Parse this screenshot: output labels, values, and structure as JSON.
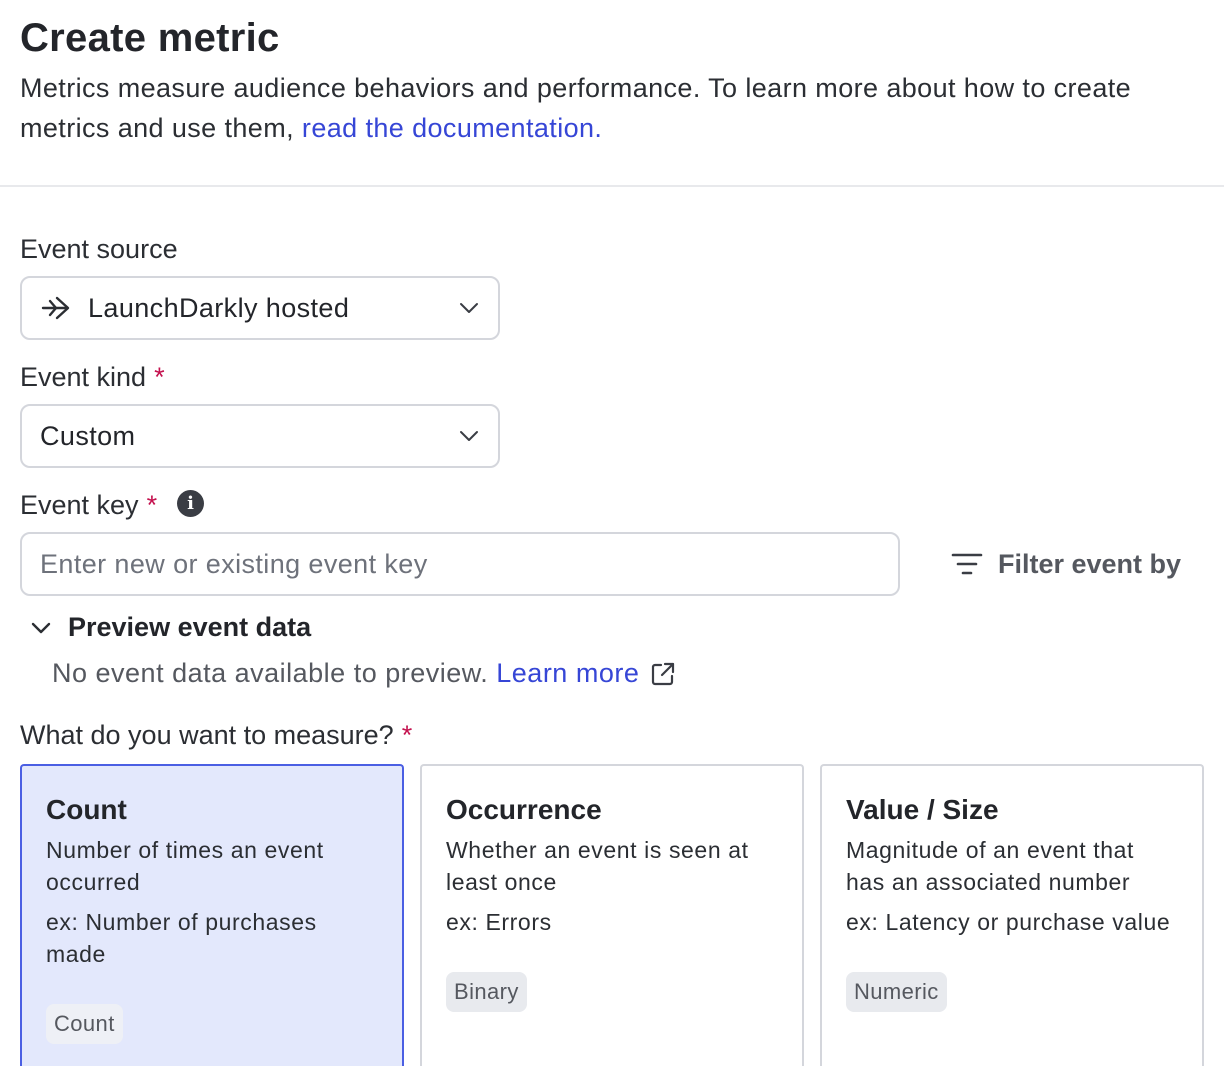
{
  "header": {
    "title": "Create metric",
    "description": "Metrics measure audience behaviors and performance. To learn more about how to create metrics and use them,",
    "doc_link": "read the documentation."
  },
  "event_source": {
    "label": "Event source",
    "value": "LaunchDarkly hosted",
    "icon": "arrow-right-icon"
  },
  "event_kind": {
    "label": "Event kind",
    "required_mark": "*",
    "value": "Custom"
  },
  "event_key": {
    "label": "Event key",
    "required_mark": "*",
    "info": "i",
    "placeholder": "Enter new or existing event key",
    "value": ""
  },
  "filter": {
    "label": "Filter event by"
  },
  "preview": {
    "toggle_label": "Preview event data",
    "message": "No event data available to preview.",
    "learn_more": "Learn more"
  },
  "measure": {
    "label": "What do you want to measure?",
    "required_mark": "*",
    "cards": [
      {
        "title": "Count",
        "description": "Number of times an event occurred",
        "example": "ex: Number of purchases made",
        "badge": "Count",
        "selected": true
      },
      {
        "title": "Occurrence",
        "description": "Whether an event is seen at least once",
        "example": "ex: Errors",
        "badge": "Binary",
        "selected": false
      },
      {
        "title": "Value / Size",
        "description": "Magnitude of an event that has an associated number",
        "example": "ex: Latency or purchase value",
        "badge": "Numeric",
        "selected": false
      }
    ]
  },
  "colors": {
    "accent": "#3646d6",
    "required": "#c4114e",
    "selected_card_bg": "#e3e8fc",
    "selected_card_border": "#4b5fe3"
  }
}
